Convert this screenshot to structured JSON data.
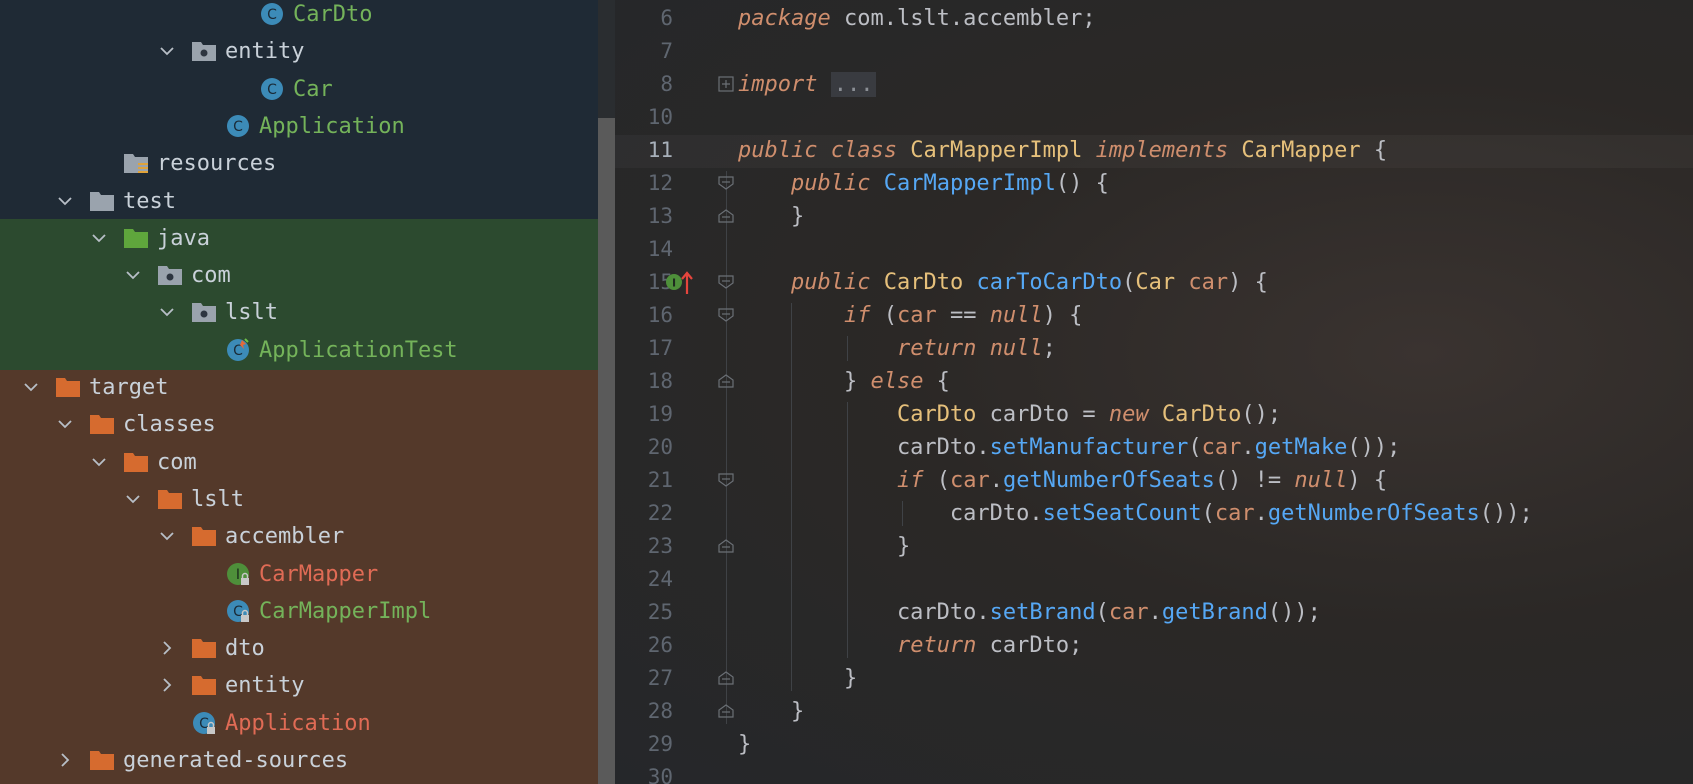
{
  "tree": {
    "rows": [
      {
        "label": "CarDto",
        "indent": 8,
        "chevron": "none",
        "icon": "class-icon",
        "style": "cls-green",
        "bg": ""
      },
      {
        "label": "entity",
        "indent": 6,
        "chevron": "down",
        "icon": "package-icon",
        "style": "",
        "bg": ""
      },
      {
        "label": "Car",
        "indent": 8,
        "chevron": "none",
        "icon": "class-icon",
        "style": "cls-green",
        "bg": ""
      },
      {
        "label": "Application",
        "indent": 7,
        "chevron": "none",
        "icon": "class-icon",
        "style": "cls-green",
        "bg": ""
      },
      {
        "label": "resources",
        "indent": 4,
        "chevron": "none",
        "icon": "resources-folder-icon",
        "style": "",
        "bg": ""
      },
      {
        "label": "test",
        "indent": 3,
        "chevron": "down",
        "icon": "folder-icon",
        "style": "",
        "bg": ""
      },
      {
        "label": "java",
        "indent": 4,
        "chevron": "down",
        "icon": "test-source-folder-icon",
        "style": "",
        "bg": "green"
      },
      {
        "label": "com",
        "indent": 5,
        "chevron": "down",
        "icon": "package-icon",
        "style": "",
        "bg": "green"
      },
      {
        "label": "lslt",
        "indent": 6,
        "chevron": "down",
        "icon": "package-icon",
        "style": "",
        "bg": "green"
      },
      {
        "label": "ApplicationTest",
        "indent": 7,
        "chevron": "none",
        "icon": "test-class-icon",
        "style": "cls-green",
        "bg": "green"
      },
      {
        "label": "target",
        "indent": 2,
        "chevron": "down",
        "icon": "excluded-folder-icon",
        "style": "",
        "bg": "orange"
      },
      {
        "label": "classes",
        "indent": 3,
        "chevron": "down",
        "icon": "excluded-folder-icon",
        "style": "",
        "bg": "orange"
      },
      {
        "label": "com",
        "indent": 4,
        "chevron": "down",
        "icon": "excluded-folder-icon",
        "style": "",
        "bg": "orange"
      },
      {
        "label": "lslt",
        "indent": 5,
        "chevron": "down",
        "icon": "excluded-folder-icon",
        "style": "",
        "bg": "orange"
      },
      {
        "label": "accembler",
        "indent": 6,
        "chevron": "down",
        "icon": "excluded-folder-icon",
        "style": "",
        "bg": "orange"
      },
      {
        "label": "CarMapper",
        "indent": 7,
        "chevron": "none",
        "icon": "interface-locked-icon",
        "style": "cls-red",
        "bg": "orange"
      },
      {
        "label": "CarMapperImpl",
        "indent": 7,
        "chevron": "none",
        "icon": "class-locked-icon",
        "style": "cls-green",
        "bg": "orange"
      },
      {
        "label": "dto",
        "indent": 6,
        "chevron": "right",
        "icon": "excluded-folder-icon",
        "style": "",
        "bg": "orange"
      },
      {
        "label": "entity",
        "indent": 6,
        "chevron": "right",
        "icon": "excluded-folder-icon",
        "style": "",
        "bg": "orange"
      },
      {
        "label": "Application",
        "indent": 6,
        "chevron": "none",
        "icon": "class-locked-icon",
        "style": "cls-red",
        "bg": "orange"
      },
      {
        "label": "generated-sources",
        "indent": 3,
        "chevron": "right",
        "icon": "excluded-folder-icon",
        "style": "",
        "bg": "orange"
      }
    ]
  },
  "editor": {
    "line_numbers": [
      "6",
      "7",
      "8",
      "10",
      "11",
      "12",
      "13",
      "14",
      "15",
      "16",
      "17",
      "18",
      "19",
      "20",
      "21",
      "22",
      "23",
      "24",
      "25",
      "26",
      "27",
      "28",
      "29",
      "30"
    ],
    "current_line": "11",
    "lines": [
      {
        "n": "6",
        "tokens": [
          [
            "kw",
            "package"
          ],
          [
            "",
            " com.lslt.accembler;"
          ]
        ]
      },
      {
        "n": "7",
        "tokens": []
      },
      {
        "n": "8",
        "tokens": [
          [
            "kw",
            "import"
          ],
          [
            "",
            " "
          ],
          [
            "fold-box",
            "..."
          ]
        ]
      },
      {
        "n": "10",
        "tokens": []
      },
      {
        "n": "11",
        "tokens": [
          [
            "kw",
            "public"
          ],
          [
            "",
            " "
          ],
          [
            "kw",
            "class"
          ],
          [
            "",
            " "
          ],
          [
            "cls",
            "CarMapperImpl"
          ],
          [
            "",
            " "
          ],
          [
            "kw",
            "implements"
          ],
          [
            "",
            " "
          ],
          [
            "cls",
            "CarMapper"
          ],
          [
            "",
            " {"
          ]
        ]
      },
      {
        "n": "12",
        "tokens": [
          [
            "",
            "    "
          ],
          [
            "kw",
            "public"
          ],
          [
            "",
            " "
          ],
          [
            "mth",
            "CarMapperImpl"
          ],
          [
            "",
            "() {"
          ]
        ]
      },
      {
        "n": "13",
        "tokens": [
          [
            "",
            "    }"
          ]
        ]
      },
      {
        "n": "14",
        "tokens": []
      },
      {
        "n": "15",
        "tokens": [
          [
            "",
            "    "
          ],
          [
            "kw",
            "public"
          ],
          [
            "",
            " "
          ],
          [
            "cls",
            "CarDto"
          ],
          [
            "",
            " "
          ],
          [
            "mth",
            "carToCarDto"
          ],
          [
            "",
            "("
          ],
          [
            "cls",
            "Car"
          ],
          [
            "",
            " "
          ],
          [
            "par",
            "car"
          ],
          [
            "",
            ") {"
          ]
        ]
      },
      {
        "n": "16",
        "tokens": [
          [
            "",
            "        "
          ],
          [
            "kw",
            "if"
          ],
          [
            "",
            " ("
          ],
          [
            "par",
            "car"
          ],
          [
            "",
            " == "
          ],
          [
            "kw",
            "null"
          ],
          [
            "",
            ") {"
          ]
        ]
      },
      {
        "n": "17",
        "tokens": [
          [
            "",
            "            "
          ],
          [
            "kw",
            "return"
          ],
          [
            "",
            " "
          ],
          [
            "kw",
            "null"
          ],
          [
            "",
            ";"
          ]
        ]
      },
      {
        "n": "18",
        "tokens": [
          [
            "",
            "        } "
          ],
          [
            "kw",
            "else"
          ],
          [
            "",
            " {"
          ]
        ]
      },
      {
        "n": "19",
        "tokens": [
          [
            "",
            "            "
          ],
          [
            "cls",
            "CarDto"
          ],
          [
            "",
            " carDto = "
          ],
          [
            "kw",
            "new"
          ],
          [
            "",
            " "
          ],
          [
            "cls",
            "CarDto"
          ],
          [
            "",
            "();"
          ]
        ]
      },
      {
        "n": "20",
        "tokens": [
          [
            "",
            "            carDto."
          ],
          [
            "mth",
            "setManufacturer"
          ],
          [
            "",
            "("
          ],
          [
            "par",
            "car"
          ],
          [
            "",
            "."
          ],
          [
            "mth",
            "getMake"
          ],
          [
            "",
            "());"
          ]
        ]
      },
      {
        "n": "21",
        "tokens": [
          [
            "",
            "            "
          ],
          [
            "kw",
            "if"
          ],
          [
            "",
            " ("
          ],
          [
            "par",
            "car"
          ],
          [
            "",
            "."
          ],
          [
            "mth",
            "getNumberOfSeats"
          ],
          [
            "",
            "() != "
          ],
          [
            "kw",
            "null"
          ],
          [
            "",
            ") {"
          ]
        ]
      },
      {
        "n": "22",
        "tokens": [
          [
            "",
            "                carDto."
          ],
          [
            "mth",
            "setSeatCount"
          ],
          [
            "",
            "("
          ],
          [
            "par",
            "car"
          ],
          [
            "",
            "."
          ],
          [
            "mth",
            "getNumberOfSeats"
          ],
          [
            "",
            "());"
          ]
        ]
      },
      {
        "n": "23",
        "tokens": [
          [
            "",
            "            }"
          ]
        ]
      },
      {
        "n": "24",
        "tokens": []
      },
      {
        "n": "25",
        "tokens": [
          [
            "",
            "            carDto."
          ],
          [
            "mth",
            "setBrand"
          ],
          [
            "",
            "("
          ],
          [
            "par",
            "car"
          ],
          [
            "",
            "."
          ],
          [
            "mth",
            "getBrand"
          ],
          [
            "",
            "());"
          ]
        ]
      },
      {
        "n": "26",
        "tokens": [
          [
            "",
            "            "
          ],
          [
            "kw",
            "return"
          ],
          [
            "",
            " carDto;"
          ]
        ]
      },
      {
        "n": "27",
        "tokens": [
          [
            "",
            "        }"
          ]
        ]
      },
      {
        "n": "28",
        "tokens": [
          [
            "",
            "    }"
          ]
        ]
      },
      {
        "n": "29",
        "tokens": [
          [
            "",
            "}"
          ]
        ]
      },
      {
        "n": "30",
        "tokens": []
      }
    ],
    "fold_markers": [
      {
        "line": "8",
        "type": "plus"
      },
      {
        "line": "12",
        "type": "open"
      },
      {
        "line": "13",
        "type": "close"
      },
      {
        "line": "15",
        "type": "open"
      },
      {
        "line": "16",
        "type": "open"
      },
      {
        "line": "18",
        "type": "close"
      },
      {
        "line": "21",
        "type": "open"
      },
      {
        "line": "23",
        "type": "close"
      },
      {
        "line": "27",
        "type": "close"
      },
      {
        "line": "28",
        "type": "close"
      }
    ],
    "gutter_marker": {
      "line": "15",
      "icon": "implements-method-icon"
    }
  },
  "colors": {
    "tree_bg": "#1f2a35",
    "test_bg": "#2c4a2f",
    "excluded_bg": "#54392a",
    "keyword": "#cf8e6d",
    "class": "#e6c07b",
    "method": "#56a8f5"
  }
}
